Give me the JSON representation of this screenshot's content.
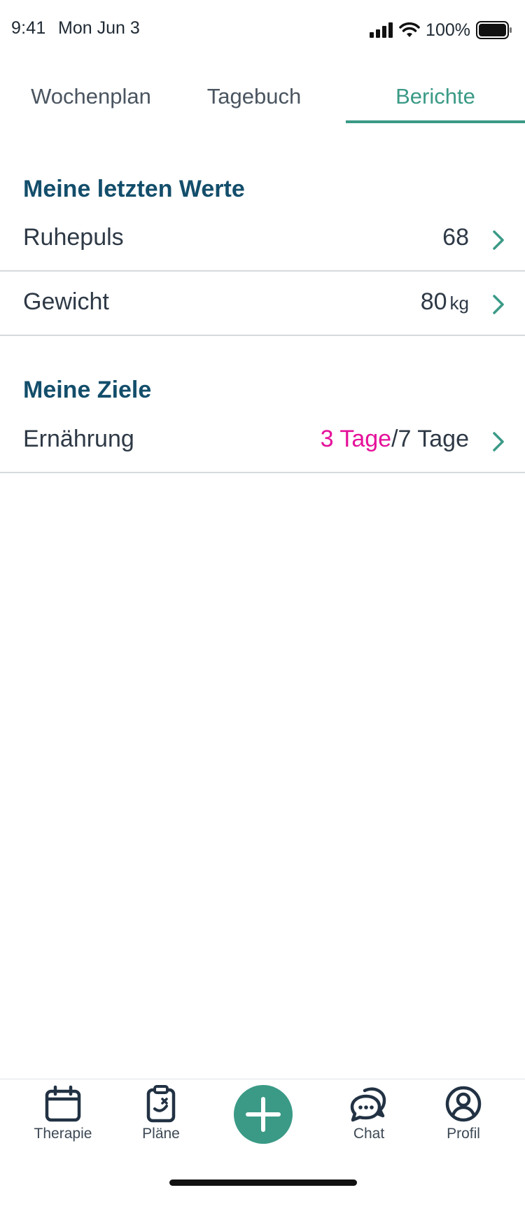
{
  "status_bar": {
    "time": "9:41",
    "date": "Mon Jun 3",
    "battery": "100%"
  },
  "tabs": [
    {
      "label": "Wochenplan",
      "active": false
    },
    {
      "label": "Tagebuch",
      "active": false
    },
    {
      "label": "Berichte",
      "active": true
    }
  ],
  "recent_values": {
    "title": "Meine letzten Werte",
    "items": [
      {
        "label": "Ruhepuls",
        "value": "68",
        "unit": ""
      },
      {
        "label": "Gewicht",
        "value": "80",
        "unit": "kg"
      }
    ]
  },
  "goals": {
    "title": "Meine Ziele",
    "items": [
      {
        "label": "Ernährung",
        "progress": "3 Tage",
        "separator": "/",
        "target": "7 Tage"
      }
    ]
  },
  "bottom_nav": {
    "items": [
      {
        "label": "Therapie",
        "icon": "calendar-icon"
      },
      {
        "label": "Pläne",
        "icon": "clipboard-icon"
      },
      {
        "label": "",
        "icon": "plus-icon"
      },
      {
        "label": "Chat",
        "icon": "chat-bubbles-icon"
      },
      {
        "label": "Profil",
        "icon": "user-circle-icon"
      }
    ]
  },
  "colors": {
    "accent": "#3a9a86",
    "section_title": "#134e6b",
    "highlight": "#e5119a",
    "text": "#2e3946"
  }
}
